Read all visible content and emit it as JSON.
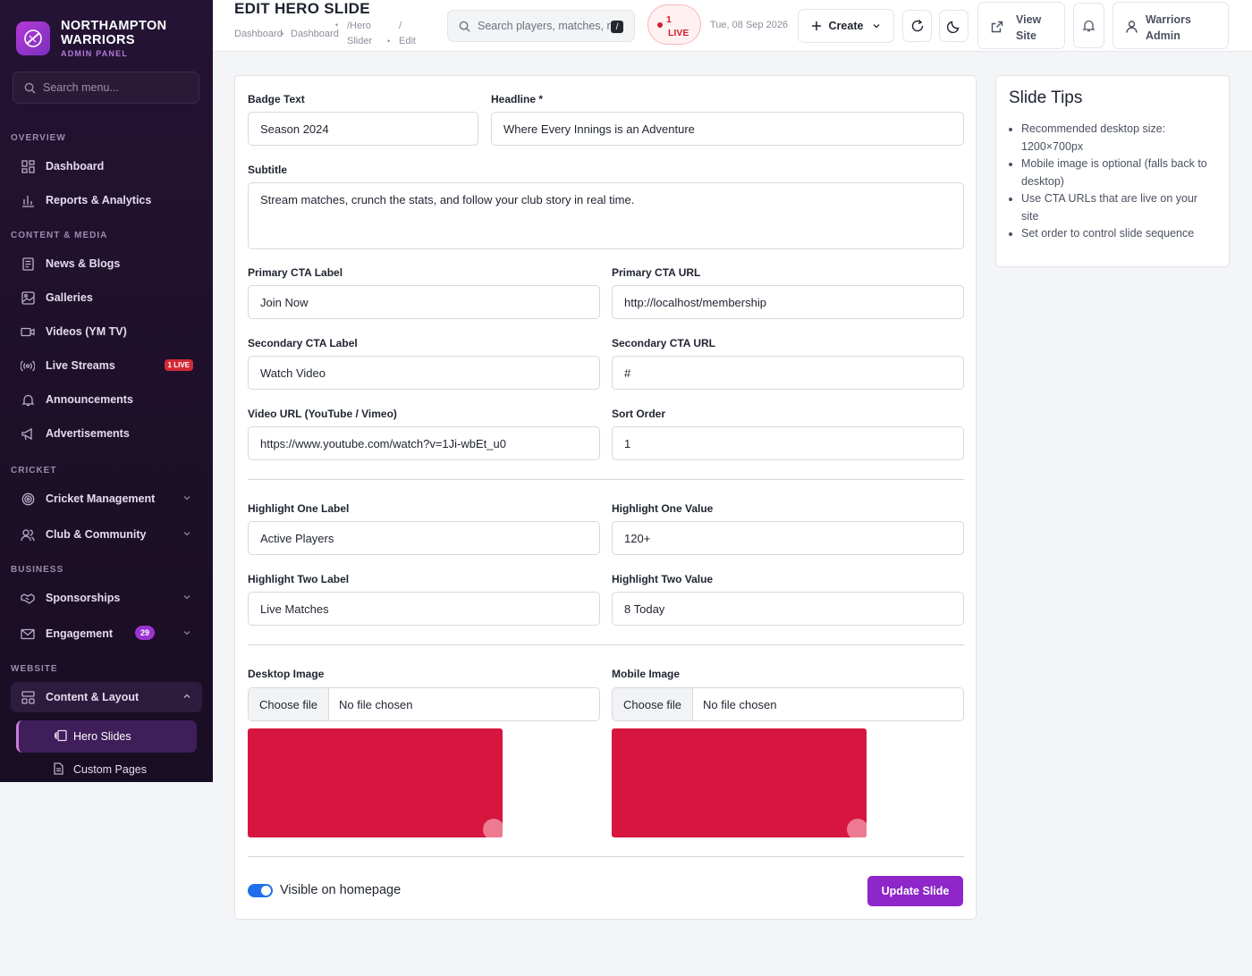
{
  "brand": {
    "name": "NORTHAMPTON WARRIORS",
    "subtitle": "ADMIN PANEL",
    "accent_color": "#9b34d0"
  },
  "sidebar": {
    "search_placeholder": "Search menu...",
    "sections": {
      "overview": "OVERVIEW",
      "content_media": "CONTENT & MEDIA",
      "cricket": "CRICKET",
      "business": "BUSINESS",
      "website": "WEBSITE"
    },
    "items": [
      {
        "label": "Dashboard",
        "icon": "grid-icon"
      },
      {
        "label": "Reports & Analytics",
        "icon": "bar-chart-icon"
      },
      {
        "label": "News & Blogs",
        "icon": "newspaper-icon"
      },
      {
        "label": "Galleries",
        "icon": "image-icon"
      },
      {
        "label": "Videos (YM TV)",
        "icon": "video-icon"
      },
      {
        "label": "Live Streams",
        "icon": "broadcast-icon",
        "badge": "1 LIVE"
      },
      {
        "label": "Announcements",
        "icon": "bell-icon"
      },
      {
        "label": "Advertisements",
        "icon": "megaphone-icon"
      },
      {
        "label": "Cricket Management",
        "icon": "target-icon"
      },
      {
        "label": "Club & Community",
        "icon": "users-icon"
      },
      {
        "label": "Sponsorships",
        "icon": "handshake-icon"
      },
      {
        "label": "Engagement",
        "icon": "mail-icon",
        "badge": "29"
      },
      {
        "label": "Content & Layout",
        "icon": "layout-icon"
      }
    ],
    "sub_items": [
      {
        "label": "Hero Slides",
        "icon": "slides-icon",
        "active": true
      },
      {
        "label": "Custom Pages",
        "icon": "file-icon"
      }
    ]
  },
  "header": {
    "title": "EDIT HERO SLIDE",
    "breadcrumb": [
      "Dashboard",
      "Dashboard",
      "/Hero",
      "Slider",
      "/",
      "Edit"
    ],
    "search_placeholder": "Search players, matches, r",
    "search_shortcut": "/",
    "live_count": "1",
    "live_label": "LIVE",
    "date": "Tue, 08 Sep 2026",
    "create_label": "Create",
    "view_site_line1": "View",
    "view_site_line2": "Site",
    "user_line1": "Warriors",
    "user_line2": "Admin"
  },
  "form": {
    "badge_text": {
      "label": "Badge Text",
      "value": "Season 2024"
    },
    "headline": {
      "label": "Headline *",
      "value": "Where Every Innings is an Adventure"
    },
    "subtitle": {
      "label": "Subtitle",
      "value": "Stream matches, crunch the stats, and follow your club story in real time."
    },
    "primary_cta_label": {
      "label": "Primary CTA Label",
      "value": "Join Now"
    },
    "primary_cta_url": {
      "label": "Primary CTA URL",
      "value": "http://localhost/membership"
    },
    "secondary_cta_label": {
      "label": "Secondary CTA Label",
      "value": "Watch Video"
    },
    "secondary_cta_url": {
      "label": "Secondary CTA URL",
      "value": "#"
    },
    "video_url": {
      "label": "Video URL (YouTube / Vimeo)",
      "value": "https://www.youtube.com/watch?v=1Ji-wbEt_u0"
    },
    "sort_order": {
      "label": "Sort Order",
      "value": "1"
    },
    "highlight_one_label": {
      "label": "Highlight One Label",
      "value": "Active Players"
    },
    "highlight_one_value": {
      "label": "Highlight One Value",
      "value": "120+"
    },
    "highlight_two_label": {
      "label": "Highlight Two Label",
      "value": "Live Matches"
    },
    "highlight_two_value": {
      "label": "Highlight Two Value",
      "value": "8 Today"
    },
    "desktop_image": {
      "label": "Desktop Image",
      "button": "Choose file",
      "status": "No file chosen"
    },
    "mobile_image": {
      "label": "Mobile Image",
      "button": "Choose file",
      "status": "No file chosen"
    },
    "preview_color": "#d7163f",
    "visible_label": "Visible on homepage",
    "visible": true,
    "submit_label": "Update Slide"
  },
  "tips": {
    "title": "Slide Tips",
    "items": [
      "Recommended desktop size: 1200×700px",
      "Mobile image is optional (falls back to desktop)",
      "Use CTA URLs that are live on your site",
      "Set order to control slide sequence"
    ]
  }
}
